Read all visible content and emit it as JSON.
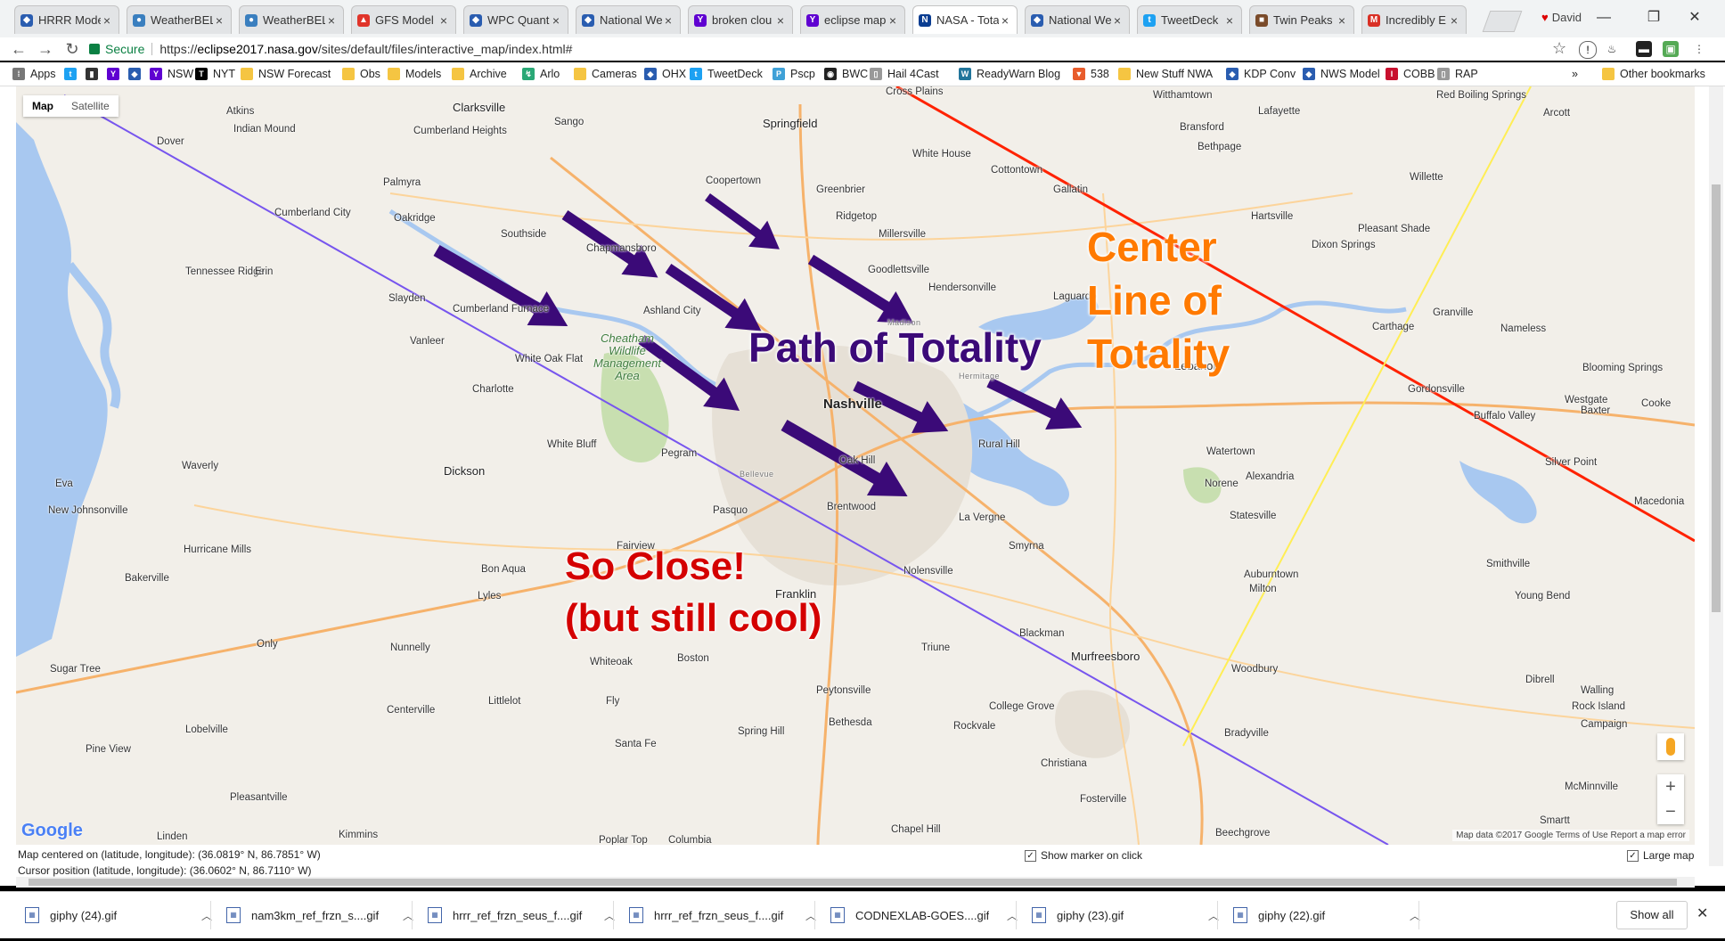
{
  "tabs": [
    {
      "label": "HRRR Mode",
      "icon": "shield",
      "active": false
    },
    {
      "label": "WeatherBEL",
      "icon": "globe",
      "active": false
    },
    {
      "label": "WeatherBEL",
      "icon": "globe",
      "active": false
    },
    {
      "label": "GFS Model",
      "icon": "flame",
      "active": false
    },
    {
      "label": "WPC Quant",
      "icon": "shield",
      "active": false
    },
    {
      "label": "National We",
      "icon": "shield",
      "active": false
    },
    {
      "label": "broken clou",
      "icon": "yahoo",
      "active": false
    },
    {
      "label": "eclipse map",
      "icon": "yahoo",
      "active": false
    },
    {
      "label": "NASA - Tota",
      "icon": "nasa",
      "active": true
    },
    {
      "label": "National We",
      "icon": "shield",
      "active": false
    },
    {
      "label": "TweetDeck",
      "icon": "twitter",
      "active": false
    },
    {
      "label": "Twin Peaks",
      "icon": "tv",
      "active": false
    },
    {
      "label": "Incredibly E",
      "icon": "gmail",
      "active": false
    }
  ],
  "user": {
    "name": "David"
  },
  "address": {
    "secure_label": "Secure",
    "url_prefix": "https://",
    "url_host": "eclipse2017.nasa.gov",
    "url_path": "/sites/default/files/interactive_map/index.html#"
  },
  "bookmarks": [
    {
      "label": "Apps",
      "icon": "apps"
    },
    {
      "label": "",
      "icon": "twitter"
    },
    {
      "label": "",
      "icon": "bookmark"
    },
    {
      "label": "",
      "icon": "yahoo"
    },
    {
      "label": "",
      "icon": "shield"
    },
    {
      "label": "NSW",
      "icon": "yahoo"
    },
    {
      "label": "NYT",
      "icon": "nyt"
    },
    {
      "label": "NSW Forecast",
      "icon": "folder"
    },
    {
      "label": "Obs",
      "icon": "folder"
    },
    {
      "label": "Models",
      "icon": "folder"
    },
    {
      "label": "Archive",
      "icon": "folder"
    },
    {
      "label": "Arlo",
      "icon": "arlo"
    },
    {
      "label": "Cameras",
      "icon": "folder"
    },
    {
      "label": "OHX",
      "icon": "shield"
    },
    {
      "label": "TweetDeck",
      "icon": "twitter"
    },
    {
      "label": "Pscp",
      "icon": "periscope"
    },
    {
      "label": "BWC",
      "icon": "bwc"
    },
    {
      "label": "Hail 4Cast",
      "icon": "page"
    },
    {
      "label": "ReadyWarn Blog",
      "icon": "wordpress"
    },
    {
      "label": "538",
      "icon": "538"
    },
    {
      "label": "New Stuff NWA",
      "icon": "folder"
    },
    {
      "label": "KDP Conv",
      "icon": "shield"
    },
    {
      "label": "NWS Model",
      "icon": "shield"
    },
    {
      "label": "COBB",
      "icon": "isu"
    },
    {
      "label": "RAP",
      "icon": "page"
    }
  ],
  "bookmarks_more": "»",
  "other_bookmarks": "Other bookmarks",
  "map": {
    "type_buttons": {
      "map": "Map",
      "satellite": "Satellite"
    },
    "places": [
      {
        "name": "Clarksville",
        "cls": "big"
      },
      {
        "name": "Atkins",
        "cls": ""
      },
      {
        "name": "Indian Mound",
        "cls": ""
      },
      {
        "name": "Dover",
        "cls": ""
      },
      {
        "name": "Sango",
        "cls": ""
      },
      {
        "name": "Cumberland Heights",
        "cls": ""
      },
      {
        "name": "Palmyra",
        "cls": ""
      },
      {
        "name": "Cumberland City",
        "cls": ""
      },
      {
        "name": "Oakridge",
        "cls": ""
      },
      {
        "name": "Southside",
        "cls": ""
      },
      {
        "name": "Tennessee Ridge",
        "cls": ""
      },
      {
        "name": "Erin",
        "cls": ""
      },
      {
        "name": "Slayden",
        "cls": ""
      },
      {
        "name": "Cumberland Furnace",
        "cls": ""
      },
      {
        "name": "Vanleer",
        "cls": ""
      },
      {
        "name": "White Oak Flat",
        "cls": ""
      },
      {
        "name": "Charlotte",
        "cls": ""
      },
      {
        "name": "White Bluff",
        "cls": ""
      },
      {
        "name": "Dickson",
        "cls": "big"
      },
      {
        "name": "Waverly",
        "cls": ""
      },
      {
        "name": "Eva",
        "cls": ""
      },
      {
        "name": "New Johnsonville",
        "cls": ""
      },
      {
        "name": "Hurricane Mills",
        "cls": ""
      },
      {
        "name": "Bakerville",
        "cls": ""
      },
      {
        "name": "Bon Aqua",
        "cls": ""
      },
      {
        "name": "Lyles",
        "cls": ""
      },
      {
        "name": "Only",
        "cls": ""
      },
      {
        "name": "Nunnelly",
        "cls": ""
      },
      {
        "name": "Sugar Tree",
        "cls": ""
      },
      {
        "name": "Centerville",
        "cls": ""
      },
      {
        "name": "Lobelville",
        "cls": ""
      },
      {
        "name": "Pine View",
        "cls": ""
      },
      {
        "name": "Pleasantville",
        "cls": ""
      },
      {
        "name": "Linden",
        "cls": ""
      },
      {
        "name": "Kimmins",
        "cls": ""
      },
      {
        "name": "Springfield",
        "cls": "big"
      },
      {
        "name": "Coopertown",
        "cls": ""
      },
      {
        "name": "Greenbrier",
        "cls": ""
      },
      {
        "name": "Ridgetop",
        "cls": ""
      },
      {
        "name": "Millersville",
        "cls": ""
      },
      {
        "name": "Goodlettsville",
        "cls": ""
      },
      {
        "name": "Ashland City",
        "cls": ""
      },
      {
        "name": "Chapmansboro",
        "cls": ""
      },
      {
        "name": "Pegram",
        "cls": ""
      },
      {
        "name": "Nashville",
        "cls": "city"
      },
      {
        "name": "Oak Hill",
        "cls": ""
      },
      {
        "name": "Brentwood",
        "cls": ""
      },
      {
        "name": "Pasquo",
        "cls": ""
      },
      {
        "name": "Fairview",
        "cls": ""
      },
      {
        "name": "Franklin",
        "cls": "big"
      },
      {
        "name": "Whiteoak",
        "cls": ""
      },
      {
        "name": "Boston",
        "cls": ""
      },
      {
        "name": "Littlelot",
        "cls": ""
      },
      {
        "name": "Fly",
        "cls": ""
      },
      {
        "name": "Santa Fe",
        "cls": ""
      },
      {
        "name": "Spring Hill",
        "cls": ""
      },
      {
        "name": "Peytonsville",
        "cls": ""
      },
      {
        "name": "Bethesda",
        "cls": ""
      },
      {
        "name": "Columbia",
        "cls": ""
      },
      {
        "name": "Poplar Top",
        "cls": ""
      },
      {
        "name": "Cross Plains",
        "cls": ""
      },
      {
        "name": "White House",
        "cls": ""
      },
      {
        "name": "Cottontown",
        "cls": ""
      },
      {
        "name": "Gallatin",
        "cls": ""
      },
      {
        "name": "Hendersonville",
        "cls": ""
      },
      {
        "name": "Laguardo",
        "cls": ""
      },
      {
        "name": "Rural Hill",
        "cls": ""
      },
      {
        "name": "La Vergne",
        "cls": ""
      },
      {
        "name": "Smyrna",
        "cls": ""
      },
      {
        "name": "Nolensville",
        "cls": ""
      },
      {
        "name": "Triune",
        "cls": ""
      },
      {
        "name": "Blackman",
        "cls": ""
      },
      {
        "name": "Murfreesboro",
        "cls": "big"
      },
      {
        "name": "College Grove",
        "cls": ""
      },
      {
        "name": "Rockvale",
        "cls": ""
      },
      {
        "name": "Christiana",
        "cls": ""
      },
      {
        "name": "Fosterville",
        "cls": ""
      },
      {
        "name": "Chapel Hill",
        "cls": ""
      },
      {
        "name": "Beechgrove",
        "cls": ""
      },
      {
        "name": "Lebanon",
        "cls": "big"
      },
      {
        "name": "Watertown",
        "cls": ""
      },
      {
        "name": "Norene",
        "cls": ""
      },
      {
        "name": "Statesville",
        "cls": ""
      },
      {
        "name": "Alexandria",
        "cls": ""
      },
      {
        "name": "Auburntown",
        "cls": ""
      },
      {
        "name": "Milton",
        "cls": ""
      },
      {
        "name": "Woodbury",
        "cls": ""
      },
      {
        "name": "Bradyville",
        "cls": ""
      },
      {
        "name": "Witthamtown",
        "cls": ""
      },
      {
        "name": "Bransford",
        "cls": ""
      },
      {
        "name": "Bethpage",
        "cls": ""
      },
      {
        "name": "Lafayette",
        "cls": ""
      },
      {
        "name": "Red Boiling Springs",
        "cls": ""
      },
      {
        "name": "Arcott",
        "cls": ""
      },
      {
        "name": "Willette",
        "cls": ""
      },
      {
        "name": "Hartsville",
        "cls": ""
      },
      {
        "name": "Pleasant Shade",
        "cls": ""
      },
      {
        "name": "Dixon Springs",
        "cls": ""
      },
      {
        "name": "Carthage",
        "cls": ""
      },
      {
        "name": "Granville",
        "cls": ""
      },
      {
        "name": "Nameless",
        "cls": ""
      },
      {
        "name": "Gordonsville",
        "cls": ""
      },
      {
        "name": "Buffalo Valley",
        "cls": ""
      },
      {
        "name": "Blooming Springs",
        "cls": ""
      },
      {
        "name": "Westgate",
        "cls": ""
      },
      {
        "name": "Baxter",
        "cls": ""
      },
      {
        "name": "Cooke",
        "cls": ""
      },
      {
        "name": "Silver Point",
        "cls": ""
      },
      {
        "name": "Macedonia",
        "cls": ""
      },
      {
        "name": "Smithville",
        "cls": ""
      },
      {
        "name": "Young Bend",
        "cls": ""
      },
      {
        "name": "Dibrell",
        "cls": ""
      },
      {
        "name": "Walling",
        "cls": ""
      },
      {
        "name": "Rock Island",
        "cls": ""
      },
      {
        "name": "Campaign",
        "cls": ""
      },
      {
        "name": "McMinnville",
        "cls": ""
      },
      {
        "name": "Smartt",
        "cls": ""
      },
      {
        "name": "Madison",
        "cls": "small"
      },
      {
        "name": "Hermitage",
        "cls": "small"
      },
      {
        "name": "Bellevue",
        "cls": "small"
      },
      {
        "name": "Cheatham Wildlife Management Area",
        "cls": "area"
      }
    ],
    "annotations": {
      "path": "Path of Totality",
      "center_line_1": "Center",
      "center_line_2": "Line of",
      "center_line_3": "Totality",
      "close_line_1": "So Close!",
      "close_line_2": "(but still cool)"
    },
    "google_logo": "Google",
    "attribution": "Map data ©2017 Google   Terms of Use   Report a map error",
    "zoom_in": "+",
    "zoom_out": "−",
    "colors": {
      "center_line": "#ff2200",
      "path_limit": "#7755ee",
      "other_line": "#ffee55",
      "arrow": "#3b0a78",
      "water": "#a8c8f0",
      "park": "#c8dfb0"
    }
  },
  "info": {
    "centered": "Map centered on (latitude, longitude): (36.0819° N, 86.7851° W)",
    "cursor": "Cursor position (latitude, longitude): (36.0602° N, 86.7110° W)",
    "show_marker": "Show marker on click",
    "large_map": "Large map"
  },
  "downloads": [
    {
      "name": "giphy (24).gif"
    },
    {
      "name": "nam3km_ref_frzn_s....gif"
    },
    {
      "name": "hrrr_ref_frzn_seus_f....gif"
    },
    {
      "name": "hrrr_ref_frzn_seus_f....gif"
    },
    {
      "name": "CODNEXLAB-GOES....gif"
    },
    {
      "name": "giphy (23).gif"
    },
    {
      "name": "giphy (22).gif"
    }
  ],
  "show_all": "Show all"
}
